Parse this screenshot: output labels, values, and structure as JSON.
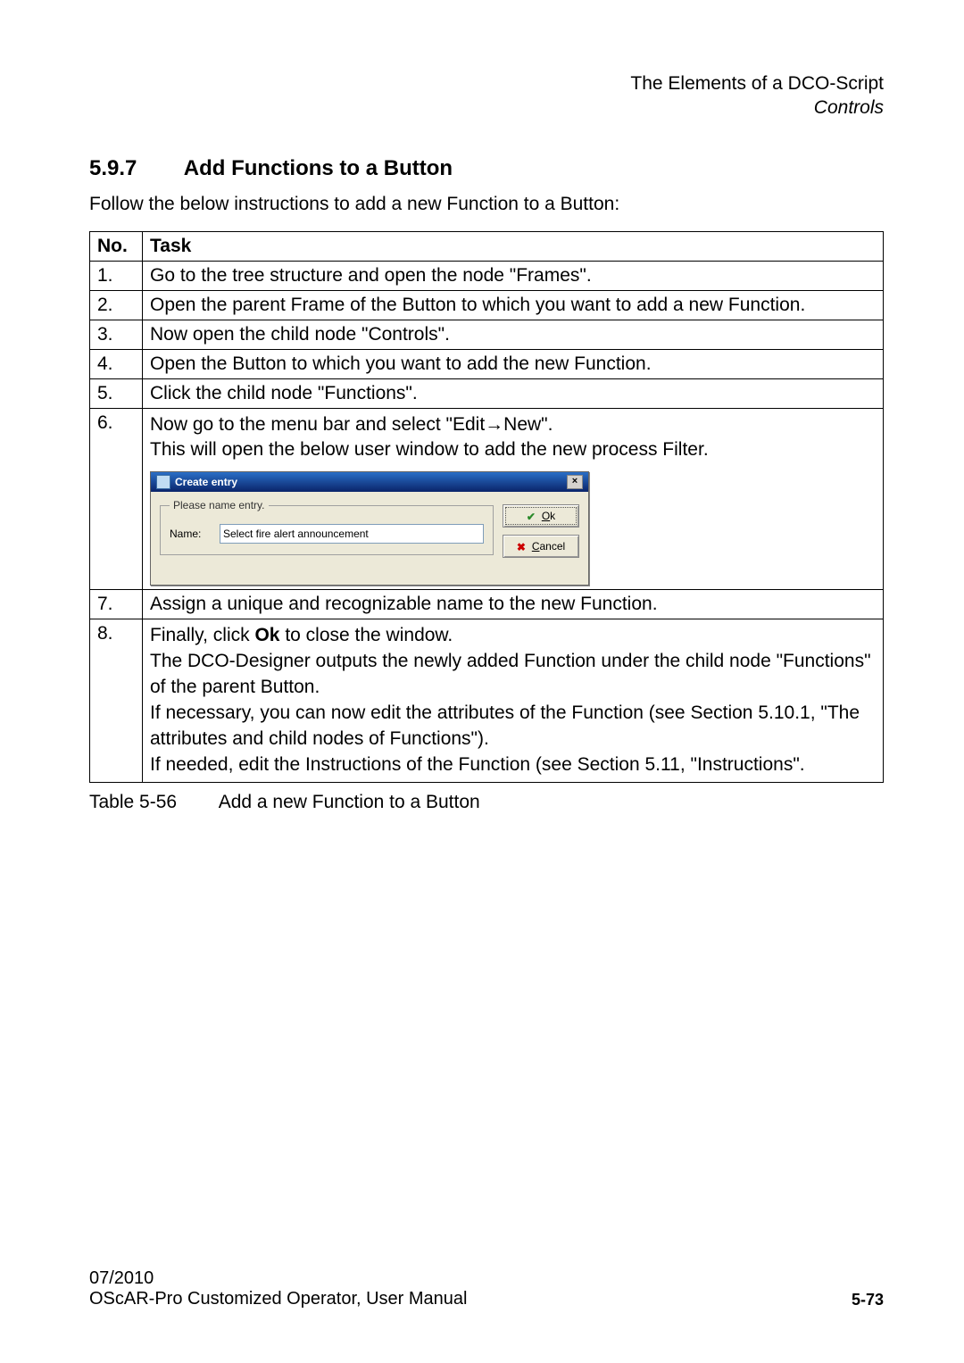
{
  "header": {
    "line1": "The Elements of a DCO-Script",
    "line2": "Controls"
  },
  "section": {
    "number": "5.9.7",
    "title": "Add Functions to a Button"
  },
  "intro": "Follow the below instructions to add a new Function to a Button:",
  "table": {
    "head_no": "No.",
    "head_task": "Task",
    "rows": {
      "r1": {
        "no": "1.",
        "task": "Go to the tree structure and open the node \"Frames\"."
      },
      "r2": {
        "no": "2.",
        "task": "Open the parent Frame of the Button to which you want to add a new Function."
      },
      "r3": {
        "no": "3.",
        "task": "Now open the child node \"Controls\"."
      },
      "r4": {
        "no": "4.",
        "task": "Open the Button to which you want to add the new Function."
      },
      "r5": {
        "no": "5.",
        "task": "Click the child node \"Functions\"."
      },
      "r6": {
        "no": "6.",
        "line1_pre": "Now go to the menu bar and select \"Edit",
        "line1_post": "New\".",
        "line2": "This will open the below user window to add the new process Filter."
      },
      "r7": {
        "no": "7.",
        "task": "Assign a unique and recognizable name to the new Function."
      },
      "r8": {
        "no": "8.",
        "part1_pre": "Finally, click ",
        "part1_bold": "Ok",
        "part1_post": " to close the window.",
        "part2": "The DCO-Designer outputs the newly added Function under the child node \"Functions\" of the parent Button.",
        "part3": "If necessary, you can now edit the attributes of the Function (see Section 5.10.1, \"The attributes and child nodes of Functions\").",
        "part4": "If needed, edit the Instructions of the Function (see Section 5.11, \"Instructions\"."
      }
    }
  },
  "dialog": {
    "title": "Create entry",
    "close": "×",
    "legend": "Please name entry.",
    "name_label": "Name:",
    "name_value": "Select fire alert announcement",
    "ok": "Ok",
    "cancel": "Cancel"
  },
  "caption": {
    "label": "Table 5-56",
    "text": "Add a new Function to a Button"
  },
  "footer": {
    "date": "07/2010",
    "doc": "OScAR-Pro Customized Operator, User Manual",
    "page": "5-73"
  },
  "arrow": "→"
}
